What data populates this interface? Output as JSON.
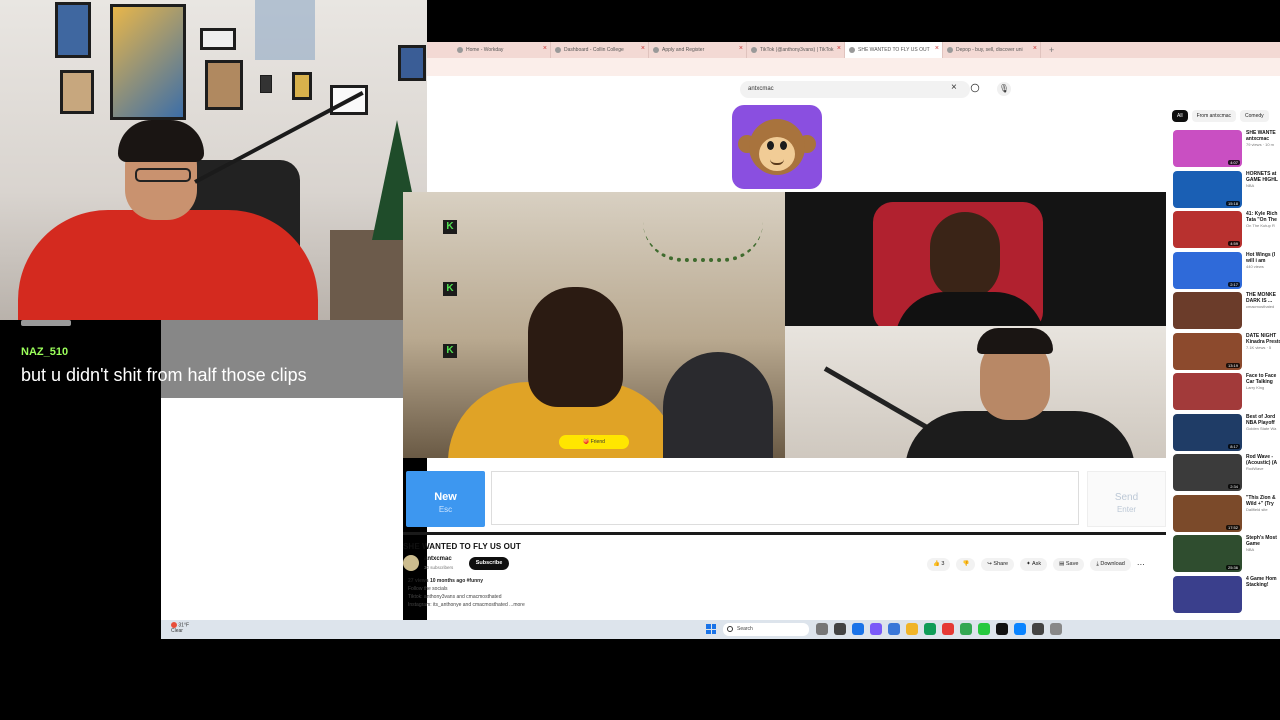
{
  "chat": {
    "username": "NAZ_510",
    "message": "but u didn't shit from half those clips"
  },
  "browser": {
    "tabs": [
      {
        "label": "Home - Workday",
        "active": false
      },
      {
        "label": "Dashboard - Collin College",
        "active": false
      },
      {
        "label": "Apply and Register",
        "active": false
      },
      {
        "label": "TikTok (@anthony3vans) | TikTok",
        "active": false
      },
      {
        "label": "SHE WANTED TO FLY US OUT",
        "active": true
      },
      {
        "label": "Depop - buy, sell, discover uni",
        "active": false
      }
    ],
    "new_tab": "+",
    "search_query": "antxcmac",
    "search_clear": "×",
    "mic": "🎙"
  },
  "omegle": {
    "k_badge": "K",
    "promo": "🍑 Friend",
    "new_label": "New",
    "new_sub": "Esc",
    "send_label": "Send",
    "send_sub": "Enter"
  },
  "video": {
    "title": "SHE WANTED TO FLY US OUT",
    "channel": "antxcmac",
    "subscribers": "30 subscribers",
    "subscribe": "Subscribe",
    "actions": {
      "like": "👍 3",
      "dislike": "👎",
      "share": "↪ Share",
      "ask": "✦ Ask",
      "save": "▤ Save",
      "download": "⤓ Download"
    },
    "more": "⋯",
    "description": {
      "meta": "27 views  10 months ago  #funny",
      "line1": "Follow the socials",
      "line2": "Tiktok: anthony3vans and cmacmosthated",
      "line3": "Instagram: its_anthonye and cmacmosthated  ...more"
    }
  },
  "sidebar": {
    "chips": [
      {
        "label": "All",
        "active": true
      },
      {
        "label": "From antxcmac",
        "active": false
      },
      {
        "label": "Comedy",
        "active": false
      }
    ],
    "recommendations": [
      {
        "title": "SHE WANTE",
        "meta1": "antxcmac",
        "meta2": "79 views · 10 m",
        "duration": "4:07",
        "color": "#c94fc2"
      },
      {
        "title": "HORNETS at",
        "meta1": "GAME HIGHL",
        "meta2": "NBA",
        "duration": "15:18",
        "color": "#1a5fb4"
      },
      {
        "title": "41: Kyle Rich",
        "meta1": "Tata \"On The",
        "meta2": "On The Kutup R",
        "duration": "4:59",
        "color": "#b8312f"
      },
      {
        "title": "Hot Wings (I",
        "meta1": "will i am",
        "meta2": "440 views",
        "duration": "2:17",
        "color": "#2f6ad9"
      },
      {
        "title": "THE MONKE",
        "meta1": "DARK IS ...",
        "meta2": "cmacmosthated",
        "duration": "",
        "color": "#6b3c2a"
      },
      {
        "title": "DATE NIGHT",
        "meta1": "Kinadra Preston",
        "meta2": "7.1K views · 5",
        "duration": "13:19",
        "color": "#8c4a2d"
      },
      {
        "title": "Face to Face",
        "meta1": "Car Talking",
        "meta2": "Larry King",
        "duration": "",
        "color": "#a23a3a"
      },
      {
        "title": "Best of Jord",
        "meta1": "NBA Playoff",
        "meta2": "Golden State Wa",
        "duration": "8:17",
        "color": "#1f3c66"
      },
      {
        "title": "Rod Wave -",
        "meta1": "(Acoustic) (A",
        "meta2": "RodWave",
        "duration": "2:34",
        "color": "#3b3b3b"
      },
      {
        "title": "\"This Zion &",
        "meta1": "Wild +\" (Try",
        "meta2": "Dallfield site",
        "duration": "17:52",
        "color": "#7b4a2a"
      },
      {
        "title": "Steph's Most",
        "meta1": "Game",
        "meta2": "NBA",
        "duration": "25:36",
        "color": "#2f4d2f"
      },
      {
        "title": "4 Game Hom",
        "meta1": "Stacking!",
        "meta2": "",
        "duration": "",
        "color": "#3a3f8c"
      }
    ]
  },
  "taskbar": {
    "weather_temp": "31°F",
    "weather_desc": "Clear",
    "search_placeholder": "Search",
    "icon_colors": [
      "#777",
      "#444",
      "#1a73e8",
      "#7a5af8",
      "#3a77d8",
      "#f0b428",
      "#0f9d58",
      "#e53935",
      "#34a853",
      "#27c93f",
      "#111",
      "#0a84ff",
      "#444",
      "#888"
    ]
  }
}
